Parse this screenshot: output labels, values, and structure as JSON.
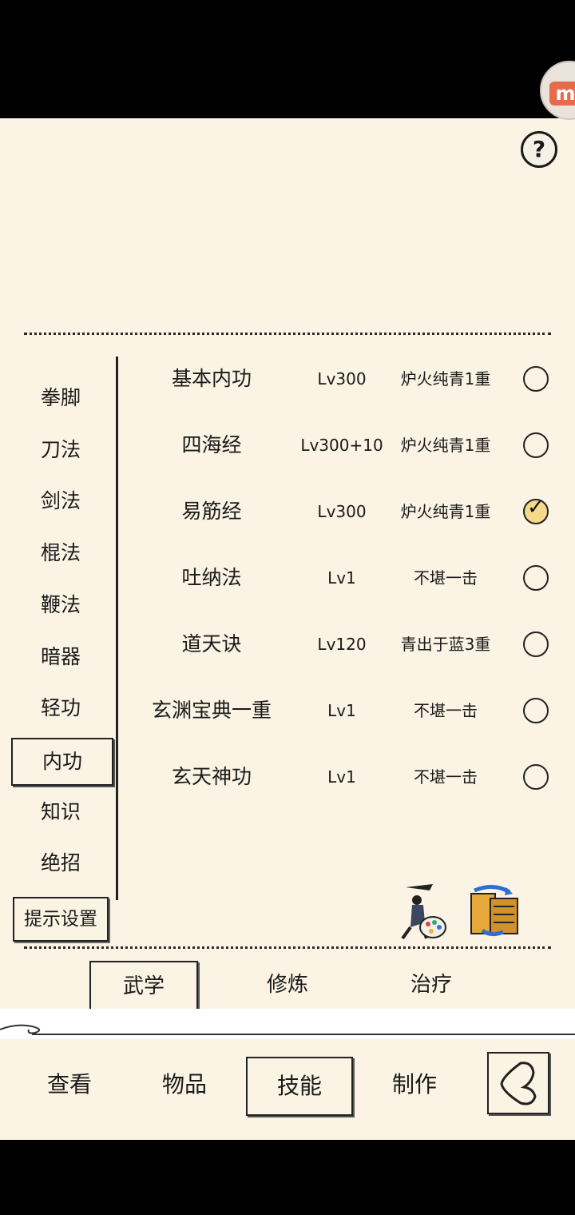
{
  "sidebar": {
    "items": [
      "拳脚",
      "刀法",
      "剑法",
      "棍法",
      "鞭法",
      "暗器",
      "轻功",
      "内功",
      "知识",
      "绝招"
    ],
    "active_index": 7,
    "hint_button": "提示设置"
  },
  "skills": [
    {
      "name": "基本内功",
      "level": "Lv300",
      "grade": "炉火纯青1重",
      "checked": false
    },
    {
      "name": "四海经",
      "level": "Lv300+10",
      "grade": "炉火纯青1重",
      "checked": false
    },
    {
      "name": "易筋经",
      "level": "Lv300",
      "grade": "炉火纯青1重",
      "checked": true
    },
    {
      "name": "吐纳法",
      "level": "Lv1",
      "grade": "不堪一击",
      "checked": false
    },
    {
      "name": "道天诀",
      "level": "Lv120",
      "grade": "青出于蓝3重",
      "checked": false
    },
    {
      "name": "玄渊宝典一重",
      "level": "Lv1",
      "grade": "不堪一击",
      "checked": false
    },
    {
      "name": "玄天神功",
      "level": "Lv1",
      "grade": "不堪一击",
      "checked": false
    }
  ],
  "sub_tabs": {
    "items": [
      "武学",
      "修炼",
      "治疗"
    ],
    "active_index": 0
  },
  "nav_tabs": {
    "items": [
      "查看",
      "物品",
      "技能",
      "制作"
    ],
    "active_index": 2
  },
  "help": {
    "label": "?"
  },
  "floating_badge": {
    "label": "m"
  },
  "icons": {
    "help": "question-icon",
    "style": "warrior-palette-icon",
    "swap": "scroll-swap-icon",
    "back": "back-arrow-icon"
  },
  "colors": {
    "panel_bg": "#fbf3e3",
    "checked_fill": "#f6d98a",
    "badge": "#e46b4b"
  }
}
